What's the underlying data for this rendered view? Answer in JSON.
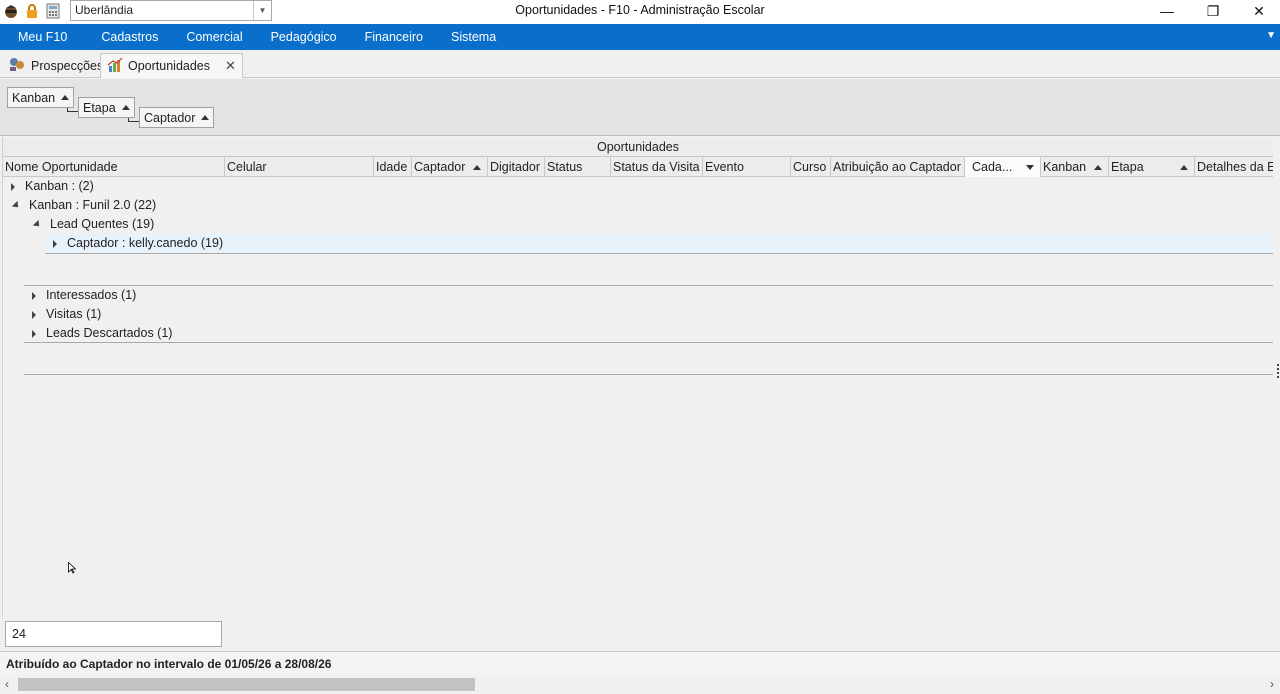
{
  "titlebar": {
    "branch_value": "Uberlândia",
    "window_title": "Oportunidades - F10 - Administração Escolar",
    "minimize": "—",
    "restore": "❐",
    "close": "✕"
  },
  "menu": {
    "items": [
      "Meu F10",
      "Cadastros",
      "Comercial",
      "Pedagógico",
      "Financeiro",
      "Sistema"
    ],
    "chevron": "⌄"
  },
  "tabs": [
    {
      "label": "Prospecções",
      "icon": "prospect-icon"
    },
    {
      "label": "Oportunidades",
      "icon": "chart-icon",
      "close": "✕"
    }
  ],
  "group_panel": {
    "levels": [
      "Kanban",
      "Etapa",
      "Captador"
    ]
  },
  "grid": {
    "band_title": "Oportunidades",
    "columns": [
      "Nome Oportunidade",
      "Celular",
      "Idade",
      "Captador",
      "Digitador",
      "Status",
      "Status da Visita",
      "Evento",
      "Curso",
      "Atribuição ao Captador",
      "Cada...",
      "Kanban",
      "Etapa",
      "Detalhes da E"
    ],
    "rows": [
      {
        "text": "Kanban :  (2)",
        "expanded": false
      },
      {
        "text": "Kanban : Funil 2.0 (22)",
        "expanded": true
      },
      {
        "text": "Lead Quentes (19)",
        "expanded": true
      },
      {
        "text": "Captador : kelly.canedo (19)",
        "expanded": false
      },
      {
        "text": "Interessados (1)",
        "expanded": false
      },
      {
        "text": "Visitas (1)",
        "expanded": false
      },
      {
        "text": "Leads Descartados (1)",
        "expanded": false
      }
    ]
  },
  "footer": {
    "count": "24",
    "status_text": "Atribuído ao Captador no intervalo de 01/05/26 a 28/08/26"
  },
  "colors": {
    "menubar": "#0a6fcb",
    "highlight_row": "#e8f2fb"
  }
}
